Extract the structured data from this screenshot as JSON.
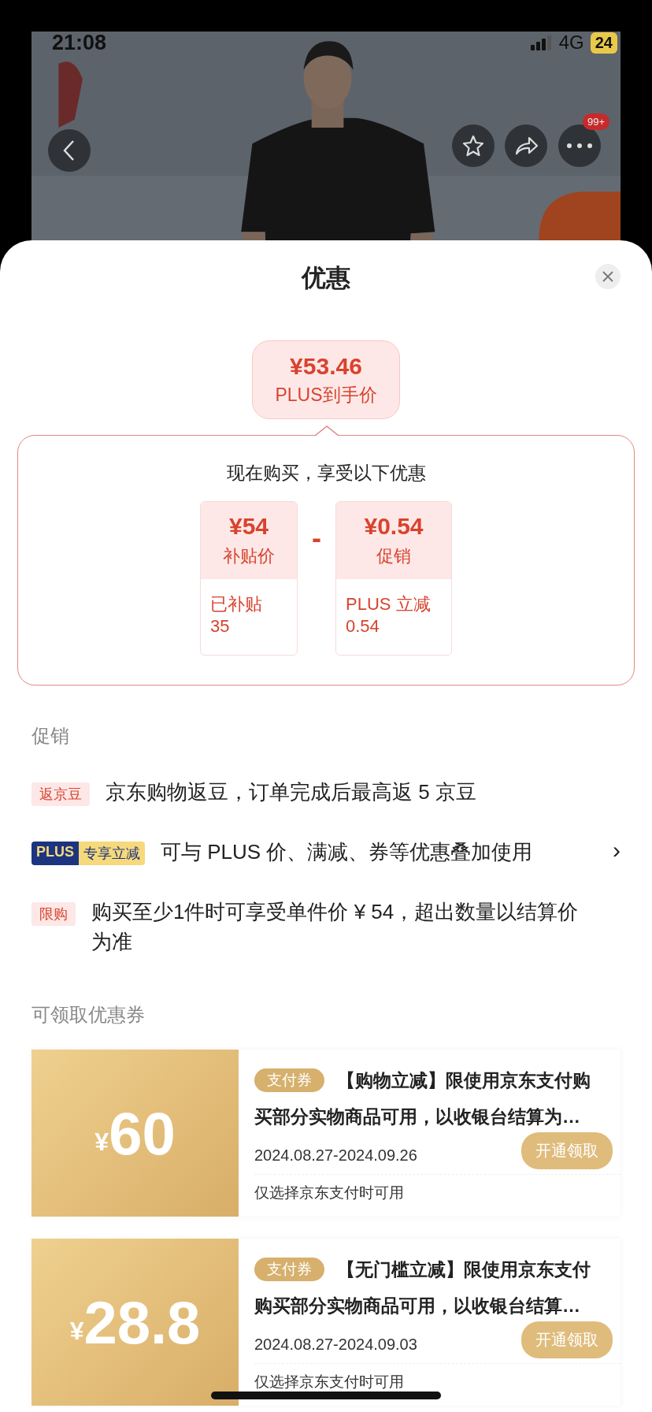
{
  "status_bar": {
    "time": "21:08",
    "network": "4G",
    "battery": "24"
  },
  "header": {
    "more_badge": "99+"
  },
  "sheet": {
    "title": "优惠"
  },
  "final_price": {
    "amount": "¥53.46",
    "label": "PLUS到手价"
  },
  "breakdown": {
    "heading": "现在购买，享受以下优惠",
    "operator": "-",
    "items": [
      {
        "amount": "¥54",
        "label": "补贴价",
        "note_lines": [
          "已补贴",
          "35"
        ]
      },
      {
        "amount": "¥0.54",
        "label": "促销",
        "note_lines": [
          "PLUS 立减",
          "0.54"
        ]
      }
    ]
  },
  "promotions": {
    "heading": "促销",
    "items": [
      {
        "kind": "tag",
        "tag": "返京豆",
        "text": "京东购物返豆，订单完成后最高返 5 京豆"
      },
      {
        "kind": "plus",
        "tag": "PLUS",
        "tag_extra": "专享立减",
        "text": "可与 PLUS 价、满减、券等优惠叠加使用",
        "arrow": "›"
      },
      {
        "kind": "tag",
        "tag": "限购",
        "text": "购买至少1件时可享受单件价 ¥ 54，超出数量以结算价为准"
      }
    ]
  },
  "coupons": {
    "heading": "可领取优惠券",
    "items": [
      {
        "currency": "¥",
        "amount": "60",
        "type_tag": "支付券",
        "title_lines": [
          "【购物立减】限使用京东支付购",
          "买部分实物商品可用，以收银台结算为…"
        ],
        "dates": "2024.08.27-2024.09.26",
        "button": "开通领取",
        "note": "仅选择京东支付时可用"
      },
      {
        "currency": "¥",
        "amount": "28.8",
        "type_tag": "支付券",
        "title_lines": [
          "【无门槛立减】限使用京东支付",
          "购买部分实物商品可用，以收银台结算…"
        ],
        "dates": "2024.08.27-2024.09.03",
        "button": "开通领取",
        "note": "仅选择京东支付时可用"
      }
    ]
  }
}
